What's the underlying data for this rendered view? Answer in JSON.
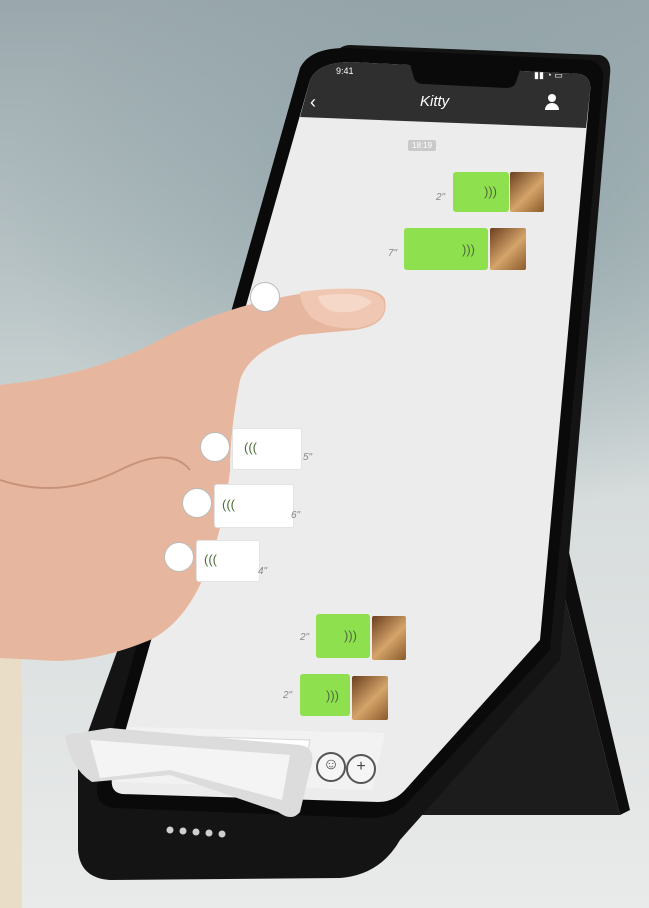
{
  "status_bar": {
    "time": "9:41"
  },
  "chat": {
    "title": "Kitty",
    "timestamp_chip": "18:19",
    "messages": [
      {
        "side": "right",
        "duration": "2\""
      },
      {
        "side": "right",
        "duration": "7\""
      },
      {
        "side": "left",
        "duration": "5\""
      },
      {
        "side": "left",
        "duration": "6\""
      },
      {
        "side": "left",
        "duration": "4\""
      },
      {
        "side": "right",
        "duration": "2\""
      },
      {
        "side": "right",
        "duration": "2\""
      }
    ]
  },
  "icons": {
    "back": "back-chevron-icon",
    "profile": "profile-icon",
    "wave": "voice-wave-icon",
    "emoji": "emoji-icon",
    "add": "plus-icon"
  },
  "colors": {
    "sent_bubble": "#8ee04f",
    "received_bubble": "#ffffff",
    "header": "#2f2f2f",
    "chat_bg": "#ececec"
  }
}
